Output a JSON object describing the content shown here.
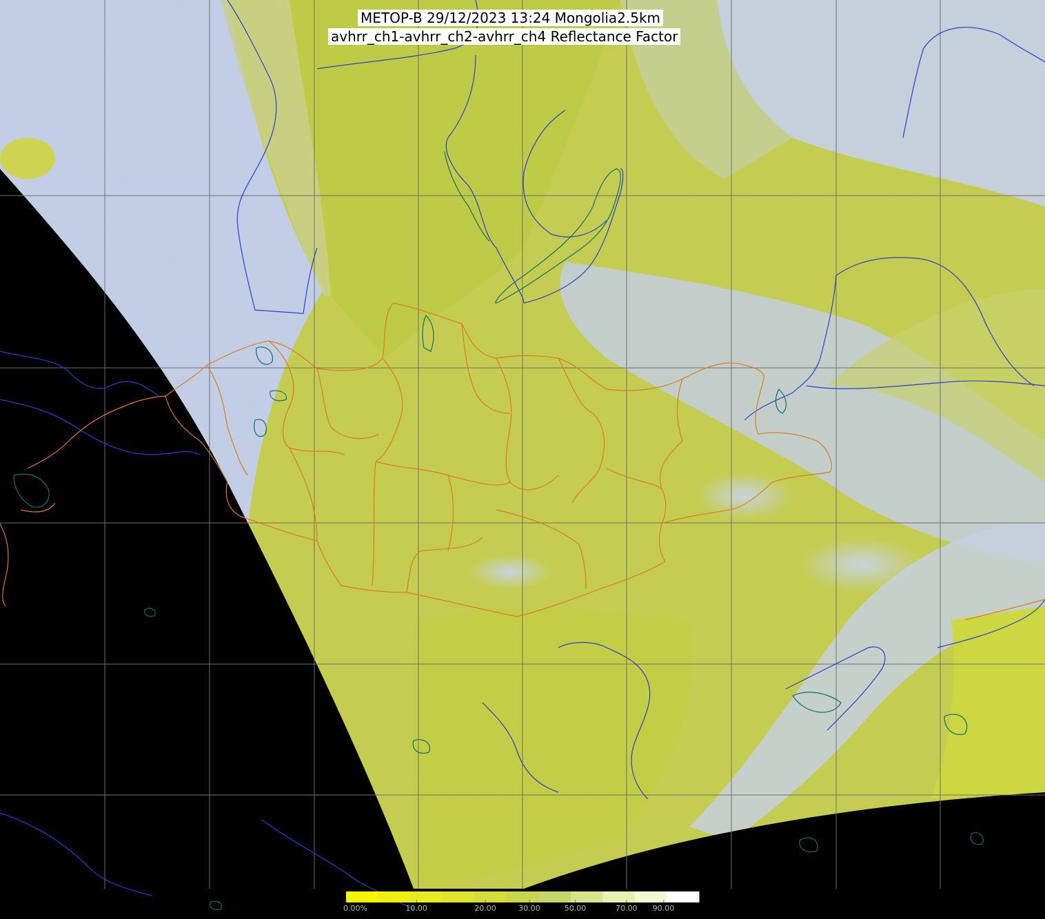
{
  "map": {
    "title_line1": "METOP-B 29/12/2023 13:24 Mongolia2.5km",
    "title_line2": "avhrr_ch1-avhrr_ch2-avhrr_ch4 Reflectance Factor",
    "colors": {
      "no_data": "#000000",
      "graticule": "#6f6f6f",
      "rivers_coast": "#2a3fd0",
      "lakes": "#0e6f6f",
      "admin_borders": "#e07a1a",
      "land_low": "#c9d43a",
      "cloud_high": "#c6d2ee"
    }
  },
  "legend": {
    "colors": [
      "#f5f500",
      "#f0f010",
      "#e8ea20",
      "#dfe52e",
      "#d5dd3a",
      "#cbd54a",
      "#c8d66a",
      "#d9e38c",
      "#e8efb0",
      "#f3f7d2",
      "#ffffff"
    ],
    "ticks": [
      {
        "label": "0.00%",
        "pos": 0
      },
      {
        "label": "10.00",
        "pos": 0.2
      },
      {
        "label": "20.00",
        "pos": 0.395
      },
      {
        "label": "30.00",
        "pos": 0.52
      },
      {
        "label": "50.00",
        "pos": 0.65
      },
      {
        "label": "70.00",
        "pos": 0.795
      },
      {
        "label": "90.00",
        "pos": 0.9
      }
    ]
  }
}
